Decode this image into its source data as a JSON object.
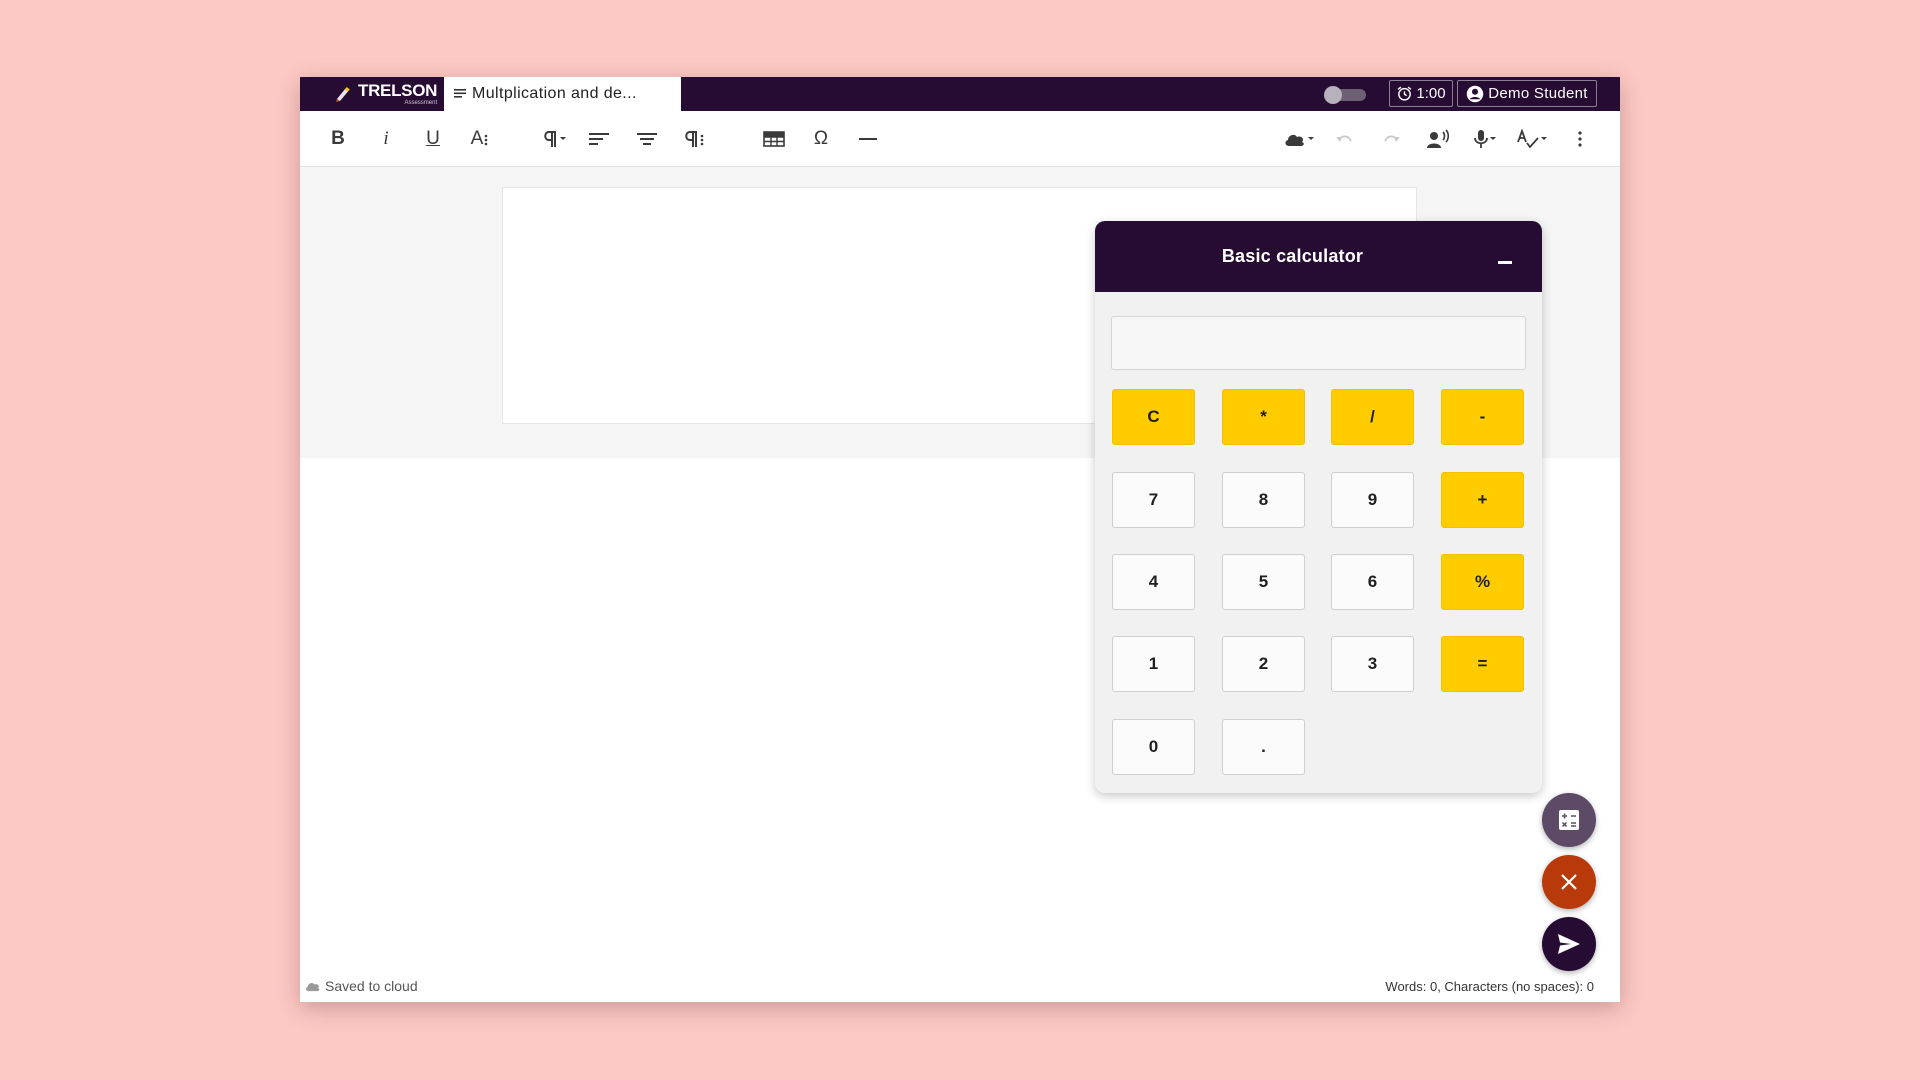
{
  "app": {
    "logo_name": "TRELSON",
    "logo_sub": "Assessment",
    "document_tab": "Multplication and de...",
    "timer": "1:00",
    "user_name": "Demo Student"
  },
  "toolbar": {
    "bold": "B",
    "italic": "i",
    "underline": "U",
    "font_size": "A",
    "special_char": "Ω"
  },
  "calculator": {
    "title": "Basic calculator",
    "display_value": "",
    "keys": {
      "clear": "C",
      "multiply": "*",
      "divide": "/",
      "subtract": "-",
      "seven": "7",
      "eight": "8",
      "nine": "9",
      "add": "+",
      "four": "4",
      "five": "5",
      "six": "6",
      "percent": "%",
      "one": "1",
      "two": "2",
      "three": "3",
      "equals": "=",
      "zero": "0",
      "decimal": "."
    }
  },
  "footer": {
    "save_status": "Saved to cloud",
    "counts": "Words: 0, Characters (no spaces): 0"
  },
  "colors": {
    "brand_dark": "#260b33",
    "accent_yellow": "#ffcc00",
    "danger": "#b83a0a",
    "background": "#fdc9c5"
  },
  "icons": {
    "toggle": "toggle-switch",
    "timer": "alarm-clock-icon",
    "user": "account-circle-icon",
    "calculator_fab": "calculator-icon",
    "close_fab": "close-icon",
    "submit_fab": "send-icon"
  }
}
